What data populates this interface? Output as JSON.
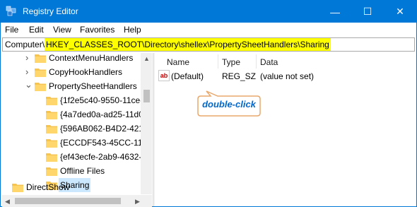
{
  "window": {
    "title": "Registry Editor"
  },
  "titlebar_buttons": {
    "minimize": "—",
    "maximize": "☐",
    "close": "✕"
  },
  "menu": [
    "File",
    "Edit",
    "View",
    "Favorites",
    "Help"
  ],
  "address": {
    "prefix": "Computer\\",
    "path": "HKEY_CLASSES_ROOT\\Directory\\shellex\\PropertySheetHandlers\\Sharing"
  },
  "tree": [
    {
      "label": "ContextMenuHandlers",
      "twisty": "›"
    },
    {
      "label": "CopyHookHandlers",
      "twisty": "›"
    },
    {
      "label": "PropertySheetHandlers",
      "twisty": "⌄"
    },
    {
      "label": "{1f2e5c40-9550-11ce-",
      "twisty": ""
    },
    {
      "label": "{4a7ded0a-ad25-11d0",
      "twisty": ""
    },
    {
      "label": "{596AB062-B4D2-421",
      "twisty": ""
    },
    {
      "label": "{ECCDF543-45CC-11(",
      "twisty": ""
    },
    {
      "label": "{ef43ecfe-2ab9-4632-",
      "twisty": ""
    },
    {
      "label": "Offline Files",
      "twisty": ""
    },
    {
      "label": "Sharing",
      "twisty": "",
      "selected": true
    },
    {
      "label": "DirectShow",
      "twisty": "›"
    }
  ],
  "list": {
    "headers": [
      "Name",
      "Type",
      "Data"
    ],
    "rows": [
      {
        "icon": "ab",
        "name": "(Default)",
        "type": "REG_SZ",
        "data": "(value not set)"
      }
    ]
  },
  "callout": {
    "text": "double-click"
  },
  "colors": {
    "titlebar": "#0078d7",
    "highlight": "#ffff00",
    "selection": "#cce8ff",
    "callout_text": "#0066cc",
    "folder": "#f5c451"
  }
}
